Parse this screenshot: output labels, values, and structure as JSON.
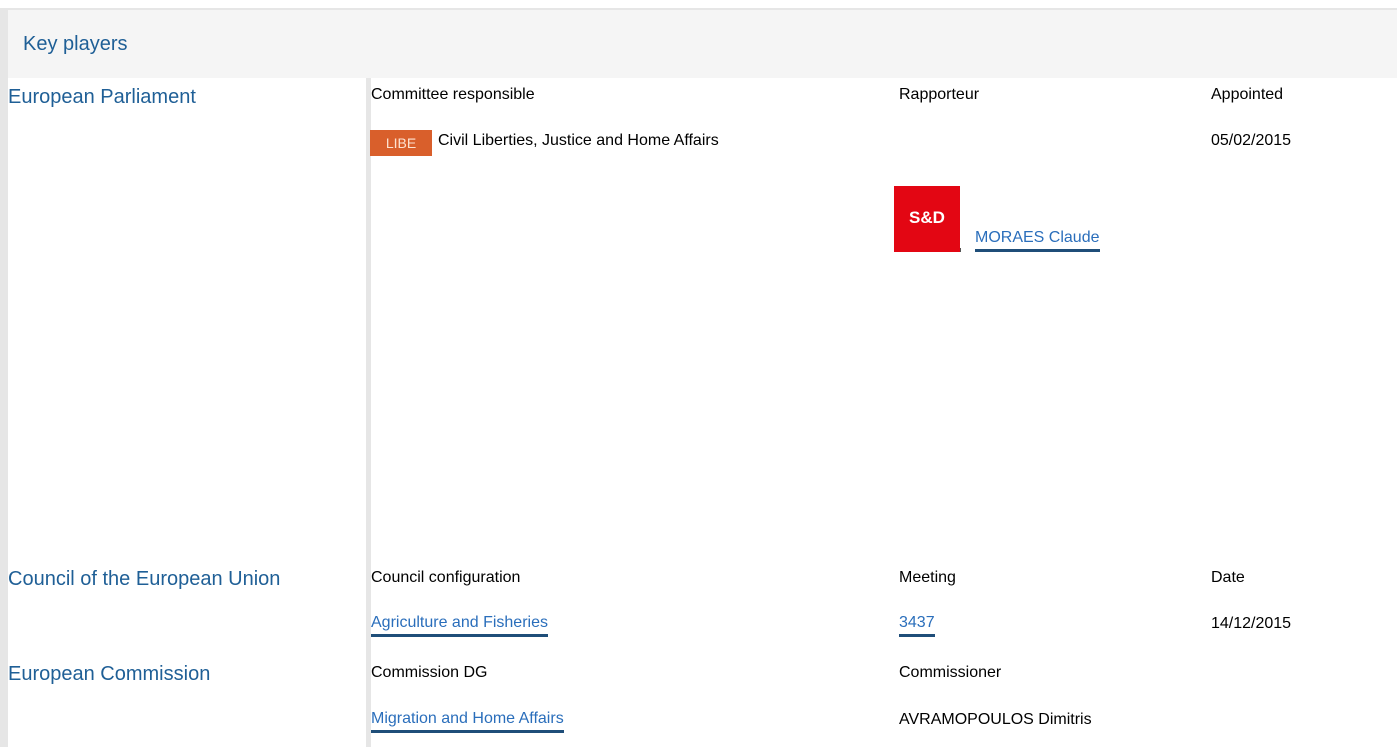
{
  "header": {
    "title": "Key players"
  },
  "parliament": {
    "label": "European Parliament",
    "col_committee": "Committee responsible",
    "col_rapporteur": "Rapporteur",
    "col_appointed": "Appointed",
    "committee_code": "LIBE",
    "committee_name": "Civil Liberties, Justice and Home Affairs",
    "appointed_date": "05/02/2015",
    "group_logo": "S&D",
    "rapporteur_name": "MORAES Claude",
    "colors": {
      "committee_badge": "#d95f2b",
      "group_logo": "#e30613"
    }
  },
  "council": {
    "label": "Council of the European Union",
    "col_configuration": "Council configuration",
    "col_meeting": "Meeting",
    "col_date": "Date",
    "configuration": "Agriculture and Fisheries",
    "meeting": "3437",
    "date": "14/12/2015"
  },
  "commission": {
    "label": "European Commission",
    "col_dg": "Commission DG",
    "col_commissioner": "Commissioner",
    "dg": "Migration and Home Affairs",
    "commissioner": "AVRAMOPOULOS Dimitris"
  },
  "theme": {
    "accent": "#1f5f96",
    "link": "#2a6ebb",
    "border": "#e6e6e6"
  }
}
